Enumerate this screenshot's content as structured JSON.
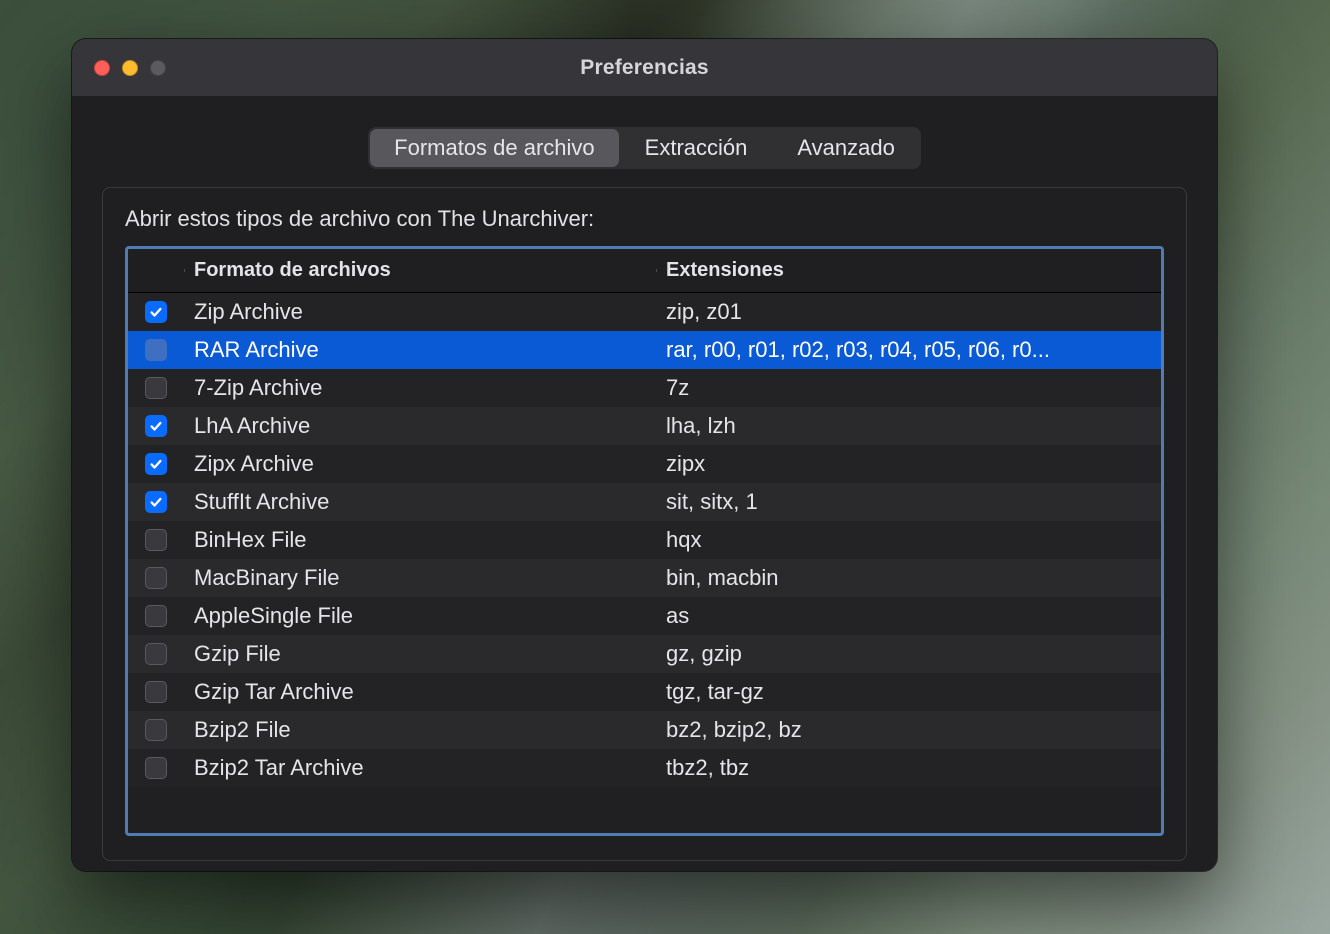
{
  "window": {
    "title": "Preferencias"
  },
  "tabs": {
    "items": [
      {
        "label": "Formatos de archivo",
        "active": true
      },
      {
        "label": "Extracción",
        "active": false
      },
      {
        "label": "Avanzado",
        "active": false
      }
    ]
  },
  "panel": {
    "heading": "Abrir estos tipos de archivo con The Unarchiver:"
  },
  "table": {
    "headers": {
      "format": "Formato de archivos",
      "extensions": "Extensiones"
    },
    "rows": [
      {
        "checked": true,
        "selected": false,
        "format": "Zip Archive",
        "ext": "zip, z01"
      },
      {
        "checked": false,
        "selected": true,
        "format": "RAR Archive",
        "ext": "rar, r00, r01, r02, r03, r04, r05, r06, r0..."
      },
      {
        "checked": false,
        "selected": false,
        "format": "7-Zip Archive",
        "ext": "7z"
      },
      {
        "checked": true,
        "selected": false,
        "format": "LhA Archive",
        "ext": "lha, lzh"
      },
      {
        "checked": true,
        "selected": false,
        "format": "Zipx Archive",
        "ext": "zipx"
      },
      {
        "checked": true,
        "selected": false,
        "format": "StuffIt Archive",
        "ext": "sit, sitx, 1"
      },
      {
        "checked": false,
        "selected": false,
        "format": "BinHex File",
        "ext": "hqx"
      },
      {
        "checked": false,
        "selected": false,
        "format": "MacBinary File",
        "ext": "bin, macbin"
      },
      {
        "checked": false,
        "selected": false,
        "format": "AppleSingle File",
        "ext": "as"
      },
      {
        "checked": false,
        "selected": false,
        "format": "Gzip File",
        "ext": "gz, gzip"
      },
      {
        "checked": false,
        "selected": false,
        "format": "Gzip Tar Archive",
        "ext": "tgz, tar-gz"
      },
      {
        "checked": false,
        "selected": false,
        "format": "Bzip2 File",
        "ext": "bz2, bzip2, bz"
      },
      {
        "checked": false,
        "selected": false,
        "format": "Bzip2 Tar Archive",
        "ext": "tbz2, tbz"
      }
    ]
  }
}
